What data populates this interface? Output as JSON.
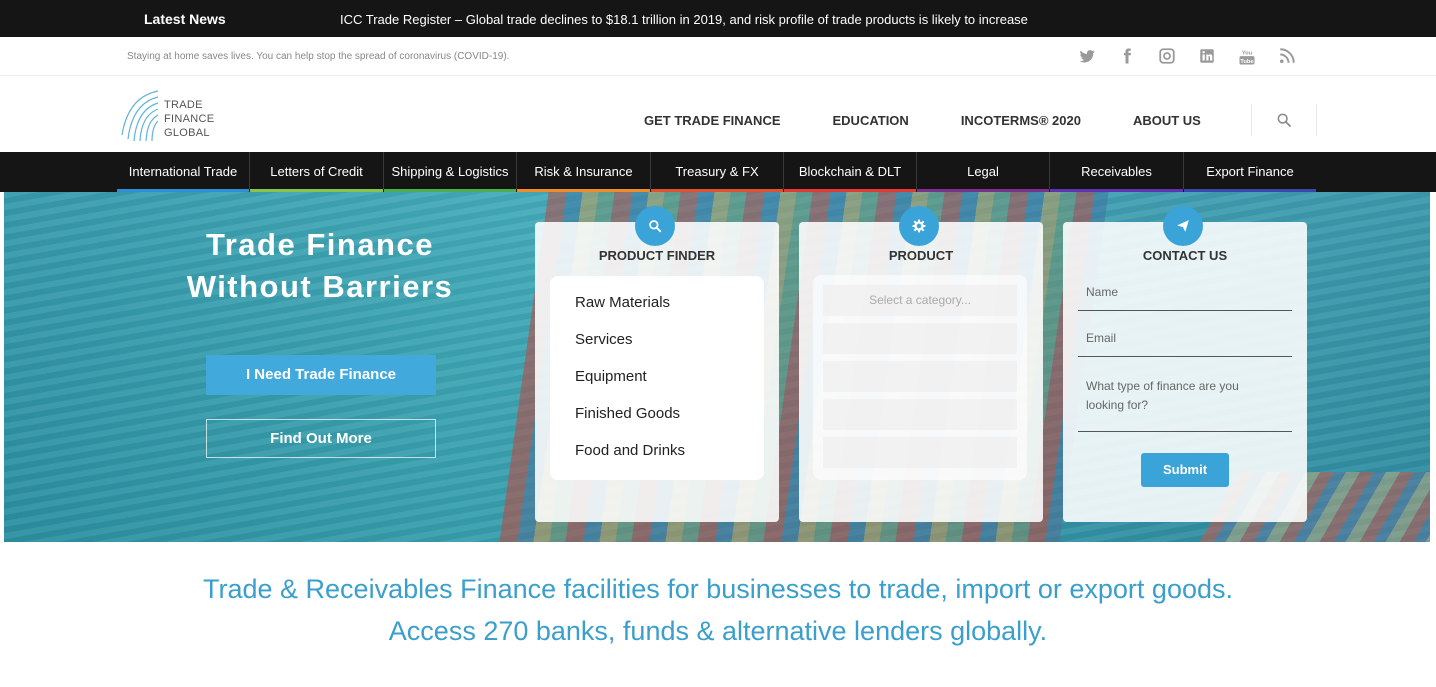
{
  "newsbar": {
    "label": "Latest News",
    "headline": "ICC Trade Register – Global trade declines to $18.1 trillion in 2019, and risk profile of trade products is likely to increase"
  },
  "covid_notice": "Staying at home saves lives. You can help stop the spread of coronavirus (COVID-19).",
  "social_icons": [
    "twitter-icon",
    "facebook-icon",
    "instagram-icon",
    "linkedin-icon",
    "youtube-icon",
    "rss-icon"
  ],
  "logo": {
    "line1": "TRADE",
    "line2": "FINANCE",
    "line3": "GLOBAL"
  },
  "main_nav": [
    "GET TRADE FINANCE",
    "EDUCATION",
    "INCOTERMS® 2020",
    "ABOUT US"
  ],
  "category_nav": [
    {
      "label": "International Trade",
      "color": "#2f8fd6"
    },
    {
      "label": "Letters of Credit",
      "color": "#8bc34a"
    },
    {
      "label": "Shipping & Logistics",
      "color": "#4caf50"
    },
    {
      "label": "Risk & Insurance",
      "color": "#f28c28"
    },
    {
      "label": "Treasury & FX",
      "color": "#e0522f"
    },
    {
      "label": "Blockchain & DLT",
      "color": "#e53935"
    },
    {
      "label": "Legal",
      "color": "#7b2f8e"
    },
    {
      "label": "Receivables",
      "color": "#5e35b1"
    },
    {
      "label": "Export Finance",
      "color": "#3949ab"
    }
  ],
  "hero": {
    "title_line1": "Trade Finance",
    "title_line2": "Without Barriers",
    "primary_button": "I Need Trade Finance",
    "secondary_button": "Find Out More"
  },
  "product_finder": {
    "title": "PRODUCT FINDER",
    "items": [
      "Raw Materials",
      "Services",
      "Equipment",
      "Finished Goods",
      "Food and Drinks"
    ]
  },
  "product": {
    "title": "PRODUCT",
    "placeholder": "Select a category..."
  },
  "contact": {
    "title": "CONTACT US",
    "name_placeholder": "Name",
    "email_placeholder": "Email",
    "message_placeholder": "What type of finance are you looking for?",
    "submit_label": "Submit"
  },
  "tagline": {
    "line1": "Trade & Receivables Finance facilities for businesses to trade, import or export goods.",
    "line2": "Access 270 banks, funds & alternative lenders globally."
  },
  "colors": {
    "accent": "#3aa3d8",
    "dark": "#151515",
    "tagline": "#3a9fcc"
  }
}
